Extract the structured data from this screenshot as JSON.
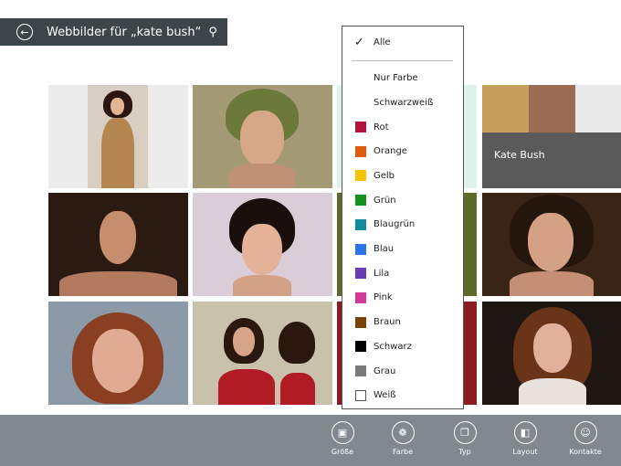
{
  "search": {
    "title": "Webbilder für „kate bush“"
  },
  "tiles": [
    {
      "caption": ""
    },
    {
      "caption": ""
    },
    {
      "caption": "Kate Bush"
    }
  ],
  "color_filter": {
    "all_label": "Alle",
    "color_only_label": "Nur Farbe",
    "bw_label": "Schwarzweiß",
    "colors": [
      {
        "label": "Rot",
        "color": "#b5123e"
      },
      {
        "label": "Orange",
        "color": "#e05c0c"
      },
      {
        "label": "Gelb",
        "color": "#f5c400"
      },
      {
        "label": "Grün",
        "color": "#12921c"
      },
      {
        "label": "Blaugrün",
        "color": "#0f8b99"
      },
      {
        "label": "Blau",
        "color": "#2a74e6"
      },
      {
        "label": "Lila",
        "color": "#6a3bb5"
      },
      {
        "label": "Pink",
        "color": "#d4399a"
      },
      {
        "label": "Braun",
        "color": "#7b4208"
      },
      {
        "label": "Schwarz",
        "color": "#000000"
      },
      {
        "label": "Grau",
        "color": "#7a7a7a"
      },
      {
        "label": "Weiß",
        "color": "#ffffff"
      }
    ]
  },
  "appbar": {
    "size_label": "Größe",
    "color_label": "Farbe",
    "type_label": "Typ",
    "layout_label": "Layout",
    "contacts_label": "Kontakte"
  }
}
